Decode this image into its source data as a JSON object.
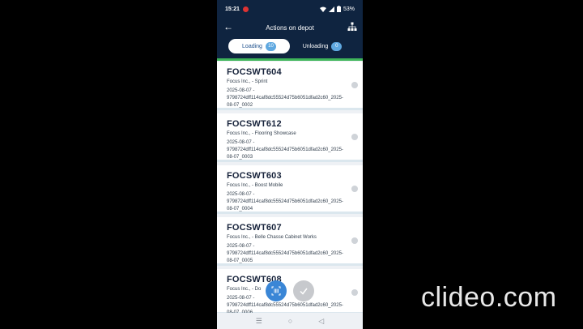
{
  "status_bar": {
    "time": "15:21",
    "battery": "53%"
  },
  "app_bar": {
    "title": "Actions on depot"
  },
  "tabs": [
    {
      "label": "Loading",
      "count": "10"
    },
    {
      "label": "Unloading",
      "count": "0"
    }
  ],
  "items": [
    {
      "code": "FOCSWT604",
      "client": "Focus Inc., - Sprint",
      "ref": "2025-08-07 - 9798724dff114caf8dc55524d75b6051dfad2c60_2025-08-07_0002"
    },
    {
      "code": "FOCSWT612",
      "client": "Focus Inc., - Flooring Showcase",
      "ref": "2025-08-07 - 9798724dff114caf8dc55524d75b6051dfad2c60_2025-08-07_0003"
    },
    {
      "code": "FOCSWT603",
      "client": "Focus Inc., - Boost Mobile",
      "ref": "2025-08-07 - 9798724dff114caf8dc55524d75b6051dfad2c60_2025-08-07_0004"
    },
    {
      "code": "FOCSWT607",
      "client": "Focus Inc., - Belle Chasse Cabinet Works",
      "ref": "2025-08-07 - 9798724dff114caf8dc55524d75b6051dfad2c60_2025-08-07_0005"
    },
    {
      "code": "FOCSWT608",
      "client": "Focus Inc., - Do",
      "ref": "2025-08-07 - 9798724dff114caf8dc55524d75b6051dfad2c60_2025-08-07_0006"
    }
  ],
  "watermark": "clideo.com",
  "icons": {
    "back": "back-arrow-icon",
    "network": "network-icon",
    "scan": "barcode-scan-icon",
    "check": "check-icon"
  }
}
